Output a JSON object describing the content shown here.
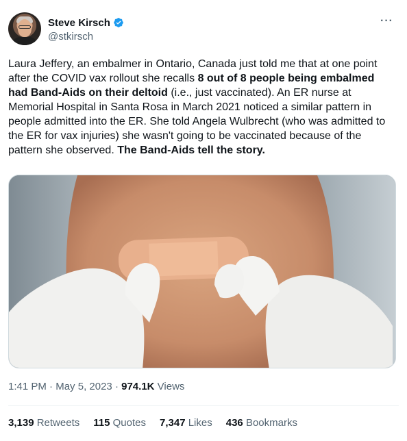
{
  "author": {
    "display_name": "Steve Kirsch",
    "handle": "@stkirsch",
    "verified_icon": "verified-badge-icon",
    "avatar_icon": "avatar"
  },
  "more_icon": "more-options-icon",
  "tweet": {
    "text_1": "Laura Jeffery, an embalmer in Ontario, Canada just told me that at one point after the COVID vax rollout she recalls ",
    "bold_1": "8 out of 8 people being embalmed had Band-Aids on their deltoid",
    "text_2": " (i.e., just vaccinated). An ER nurse at Memorial Hospital in Santa Rosa in March 2021 noticed a similar pattern in people admitted into the ER. She told Angela Wulbrecht (who was admitted to the ER for vax injuries) she wasn't going to be vaccinated because of the pattern she observed. ",
    "bold_2": "The Band-Aids tell the story."
  },
  "media": {
    "description_icon": "photo-image"
  },
  "meta": {
    "time": "1:41 PM",
    "separator": "·",
    "date": "May 5, 2023",
    "views_count": "974.1K",
    "views_label": "Views"
  },
  "stats": {
    "retweets_count": "3,139",
    "retweets_label": "Retweets",
    "quotes_count": "115",
    "quotes_label": "Quotes",
    "likes_count": "7,347",
    "likes_label": "Likes",
    "bookmarks_count": "436",
    "bookmarks_label": "Bookmarks"
  },
  "colors": {
    "text": "#0f1419",
    "secondary": "#536471",
    "verified": "#1d9bf0"
  }
}
